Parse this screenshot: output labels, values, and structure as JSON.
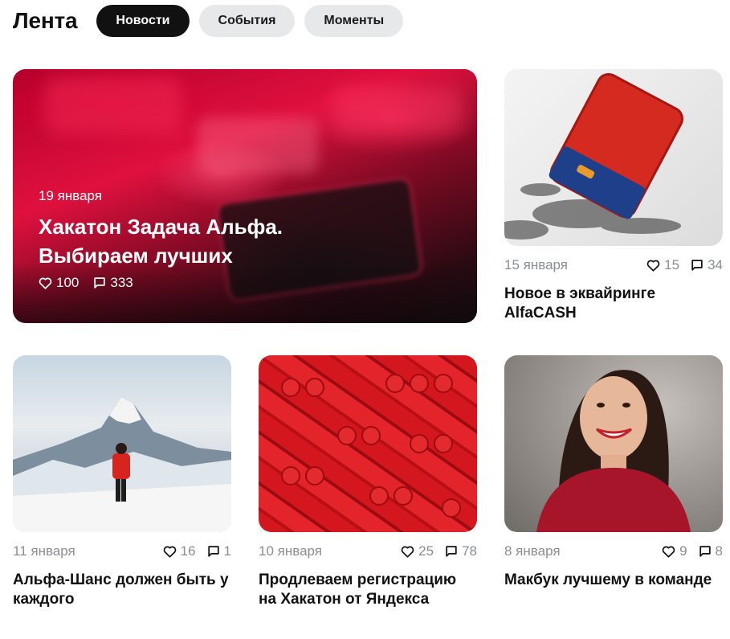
{
  "header": {
    "title": "Лента",
    "tabs": [
      {
        "label": "Новости",
        "active": true
      },
      {
        "label": "События",
        "active": false
      },
      {
        "label": "Моменты",
        "active": false
      }
    ]
  },
  "hero": {
    "date": "19 января",
    "title": "Хакатон Задача Альфа. Выбираем лучших",
    "likes": "100",
    "comments": "333"
  },
  "cards": [
    {
      "date": "15 января",
      "likes": "15",
      "comments": "34",
      "title": "Новое в эквайринге AlfaCASH"
    },
    {
      "date": "11 января",
      "likes": "16",
      "comments": "1",
      "title": "Альфа-Шанс должен быть у каждого"
    },
    {
      "date": "10 января",
      "likes": "25",
      "comments": "78",
      "title": "Продлеваем регистрацию на Хакатон от Яндекса"
    },
    {
      "date": "8 января",
      "likes": "9",
      "comments": "8",
      "title": "Макбук лучшему в команде"
    }
  ],
  "icons": {
    "like": "heart-icon",
    "comment": "comment-icon"
  },
  "colors": {
    "tab_active_bg": "#111111",
    "tab_inactive_bg": "#e6e8ea",
    "meta_text": "#8a8d91",
    "accent_red": "#ef3124"
  }
}
